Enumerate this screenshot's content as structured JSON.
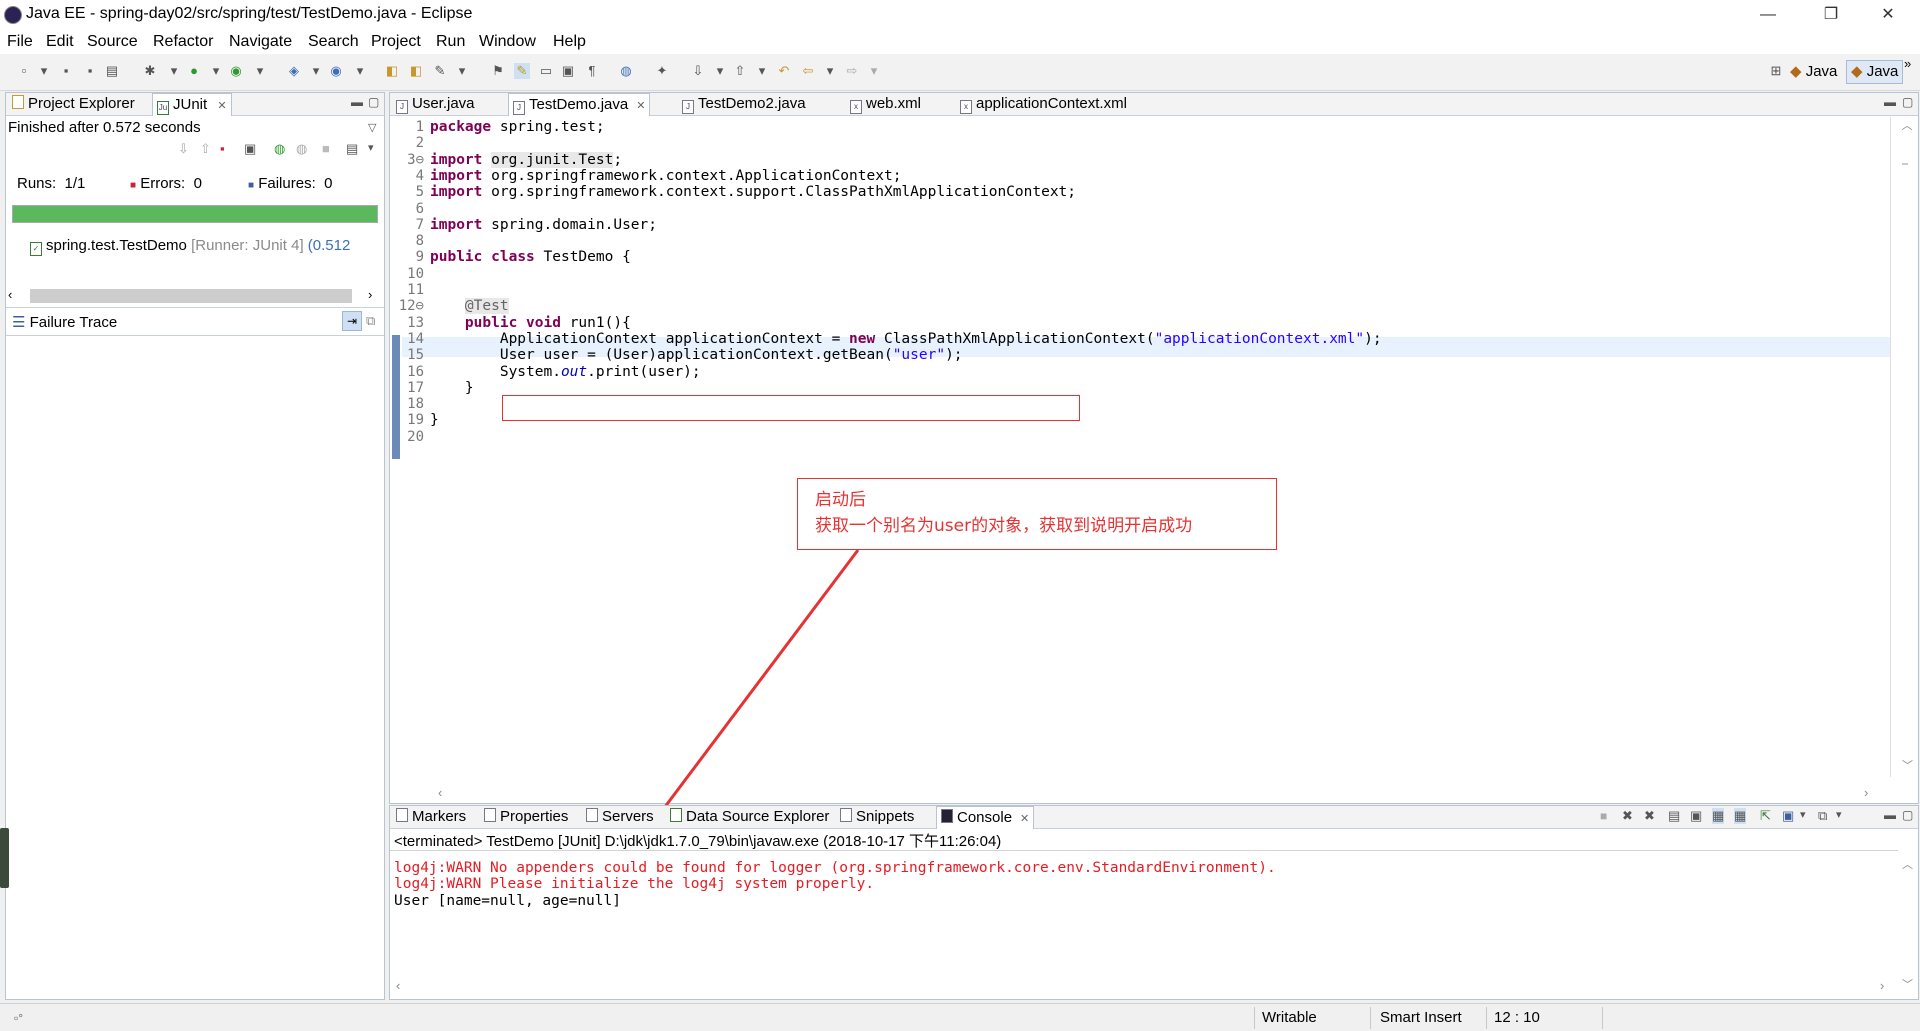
{
  "window": {
    "title": "Java EE - spring-day02/src/spring/test/TestDemo.java - Eclipse",
    "minimize": "—",
    "restore": "❐",
    "close": "✕"
  },
  "menu": [
    "File",
    "Edit",
    "Source",
    "Refactor",
    "Navigate",
    "Search",
    "Project",
    "Run",
    "Window",
    "Help"
  ],
  "perspectives": {
    "java1": "Java",
    "java2": "Java",
    "more": "»"
  },
  "left_panel": {
    "tabs": [
      {
        "label": "Project Explorer",
        "icon": "project-explorer-icon"
      },
      {
        "label": "JUnit",
        "icon": "junit-icon",
        "closable": true
      }
    ],
    "finished_text": "Finished after 0.572 seconds",
    "runs_label": "Runs:",
    "runs_value": "1/1",
    "errors_label": "Errors:",
    "errors_value": "0",
    "failures_label": "Failures:",
    "failures_value": "0",
    "progress_fraction": 1.0,
    "progress_color": "#5cb85c",
    "test_item": {
      "name": "spring.test.TestDemo",
      "runner": "[Runner: JUnit 4]",
      "time": "(0.512"
    },
    "failure_trace_label": "Failure Trace"
  },
  "editor": {
    "tabs": [
      {
        "label": "User.java",
        "active": false
      },
      {
        "label": "TestDemo.java",
        "active": true
      },
      {
        "label": "TestDemo2.java",
        "active": false
      },
      {
        "label": "web.xml",
        "active": false
      },
      {
        "label": "applicationContext.xml",
        "active": false
      }
    ],
    "line_numbers": [
      "1",
      "2",
      "3⊖",
      "4",
      "5",
      "6",
      "7",
      "8",
      "9",
      "10",
      "11",
      "12⊖",
      "13",
      "14",
      "15",
      "16",
      "17",
      "18",
      "19",
      "20"
    ],
    "lines": [
      "package spring.test;",
      "",
      "import org.junit.Test;",
      "import org.springframework.context.ApplicationContext;",
      "import org.springframework.context.support.ClassPathXmlApplicationContext;",
      "",
      "import spring.domain.User;",
      "",
      "public class TestDemo {",
      "",
      "",
      "    @Test",
      "    public void run1(){",
      "        ApplicationContext applicationContext = new ClassPathXmlApplicationContext(\"applicationContext.xml\");",
      "        User user = (User)applicationContext.getBean(\"user\");",
      "        System.out.print(user);",
      "    }",
      "",
      "}",
      ""
    ],
    "annotation_box": {
      "line1": "启动后",
      "line2": "获取一个别名为user的对象，获取到说明开启成功",
      "color": "#e53333"
    }
  },
  "bottom_panel": {
    "tabs": [
      {
        "label": "Markers"
      },
      {
        "label": "Properties"
      },
      {
        "label": "Servers"
      },
      {
        "label": "Data Source Explorer"
      },
      {
        "label": "Snippets"
      },
      {
        "label": "Console",
        "active": true
      }
    ],
    "terminated": "<terminated> TestDemo [JUnit] D:\\jdk\\jdk1.7.0_79\\bin\\javaw.exe (2018-10-17 下午11:26:04)",
    "lines": [
      {
        "text": "log4j:WARN No appenders could be found for logger (org.springframework.core.env.StandardEnvironment).",
        "color": "#e51c23"
      },
      {
        "text": "log4j:WARN Please initialize the log4j system properly.",
        "color": "#e51c23"
      },
      {
        "text": "User [name=null, age=null]",
        "color": "#000000"
      }
    ]
  },
  "status_bar": {
    "writable": "Writable",
    "insert_mode": "Smart Insert",
    "position": "12 : 10"
  }
}
